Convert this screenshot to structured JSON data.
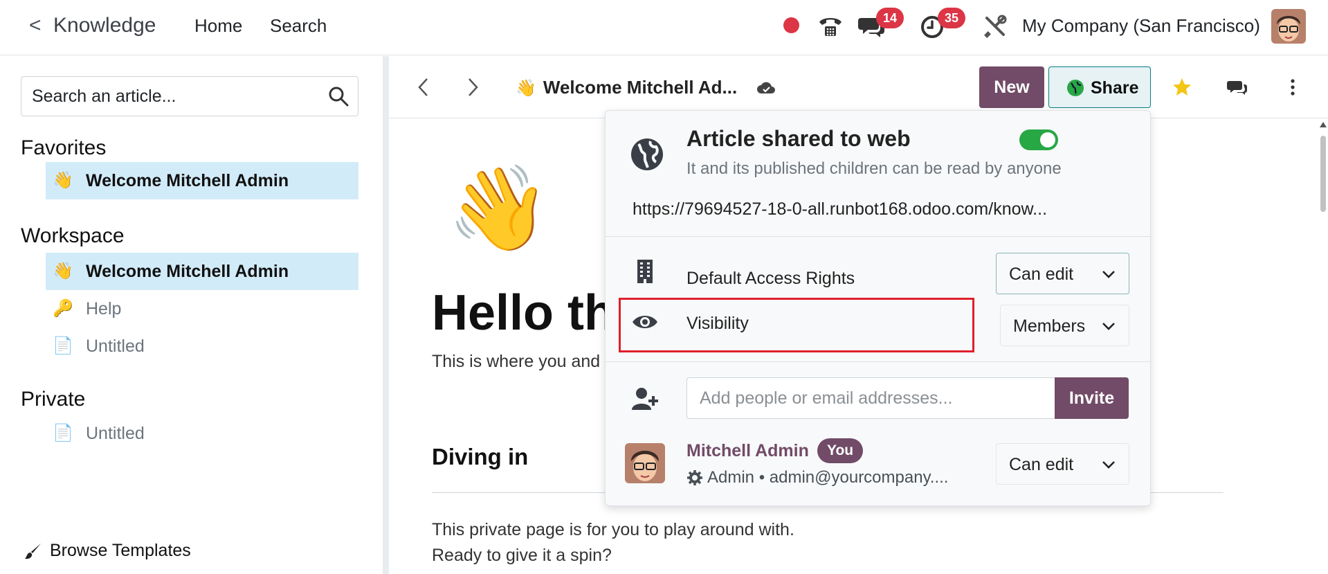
{
  "topbar": {
    "back_glyph": "<",
    "app_name": "Knowledge",
    "menu": [
      "Home",
      "Search"
    ],
    "messages_badge": "14",
    "activities_badge": "35",
    "company": "My Company (San Francisco)",
    "status_color": "#dc3545"
  },
  "sidebar": {
    "search_placeholder": "Search an article...",
    "favorites_title": "Favorites",
    "favorites": [
      {
        "emoji": "👋",
        "label": "Welcome Mitchell Admin"
      }
    ],
    "workspace_title": "Workspace",
    "workspace": [
      {
        "emoji": "👋",
        "label": "Welcome Mitchell Admin"
      },
      {
        "emoji": "🔑",
        "label": "Help"
      },
      {
        "emoji": "📄",
        "label": "Untitled"
      }
    ],
    "private_title": "Private",
    "private": [
      {
        "emoji": "📄",
        "label": "Untitled"
      }
    ],
    "browse_templates": "Browse Templates"
  },
  "toolbar": {
    "breadcrumb_emoji": "👋",
    "breadcrumb": "Welcome Mitchell Ad...",
    "new_label": "New",
    "share_label": "Share",
    "brand_color": "#714b67"
  },
  "article": {
    "emoji": "👋",
    "heading": "Hello the",
    "intro": "This is where you and",
    "section": "Diving in",
    "para1": "This private page is for you to play around with.",
    "para2": "Ready to give it a spin?"
  },
  "share_popover": {
    "title": "Article shared to web",
    "subtitle": "It and its published children can be read by anyone",
    "shared_to_web": true,
    "url": "https://79694527-18-0-all.runbot168.odoo.com/know...",
    "default_access_label": "Default Access Rights",
    "default_access_value": "Can edit",
    "visibility_label": "Visibility",
    "visibility_value": "Members",
    "invite_placeholder": "Add people or email addresses...",
    "invite_label": "Invite",
    "member": {
      "name": "Mitchell Admin",
      "badge": "You",
      "details": "Admin • admin@yourcompany....",
      "permission": "Can edit"
    }
  }
}
